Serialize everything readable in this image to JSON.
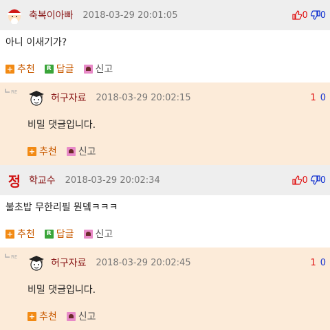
{
  "comments": [
    {
      "author": "축복이아빠",
      "date": "2018-03-29 20:01:05",
      "up": "0",
      "down": "0",
      "text": "아니 이새기가?",
      "actions": {
        "recommend": "추천",
        "reply": "답글",
        "report": "신고"
      }
    },
    {
      "author": "허구자료",
      "date": "2018-03-29 20:02:15",
      "up": "1",
      "down": "0",
      "text": "비밀 댓글입니다.",
      "actions": {
        "recommend": "추천",
        "report": "신고"
      }
    },
    {
      "avatar_char": "정",
      "author": "학교수",
      "date": "2018-03-29 20:02:34",
      "up": "0",
      "down": "0",
      "text": "불초밥 무한리필 뭔뎈ㅋㅋㅋ",
      "actions": {
        "recommend": "추천",
        "reply": "답글",
        "report": "신고"
      }
    },
    {
      "author": "허구자료",
      "date": "2018-03-29 20:02:45",
      "up": "1",
      "down": "0",
      "text": "비밀 댓글입니다.",
      "actions": {
        "recommend": "추천",
        "report": "신고"
      }
    }
  ],
  "icons": {
    "recommend": "plus-icon",
    "reply": "reply-r-icon",
    "report": "report-siren-icon",
    "thumb_up": "thumbs-up-icon",
    "thumb_down": "thumbs-down-icon",
    "reply_marker": "re-arrow-icon"
  },
  "colors": {
    "author": "#8b1a1a",
    "up": "#e01010",
    "down": "#1030d0",
    "reply_bg": "#fcebd9",
    "header_bg": "#eeeeee"
  }
}
